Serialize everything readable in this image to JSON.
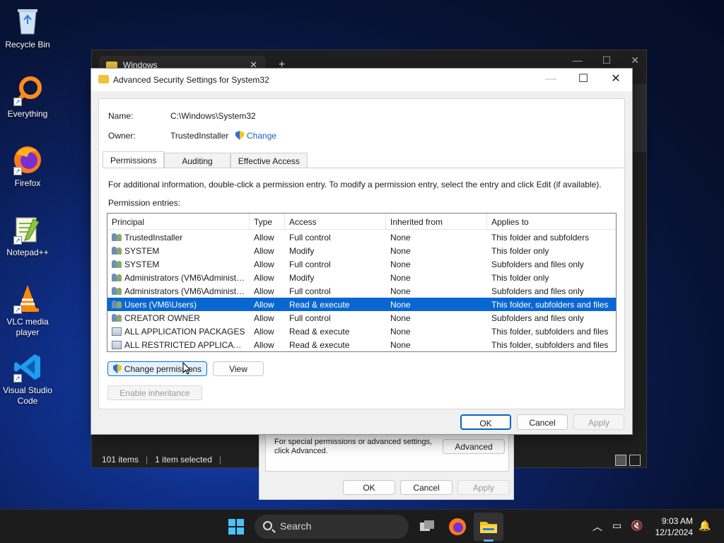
{
  "desktop": {
    "icons": [
      {
        "label": "Recycle Bin"
      },
      {
        "label": "Everything"
      },
      {
        "label": "Firefox"
      },
      {
        "label": "Notepad++"
      },
      {
        "label": "VLC media player"
      },
      {
        "label": "Visual Studio Code"
      }
    ]
  },
  "explorer": {
    "tab_title": "Windows",
    "tab_close": "✕",
    "new_tab": "+",
    "status_items": "101 items",
    "status_selected": "1 item selected"
  },
  "properties": {
    "advanced_text": "For special permissions or advanced settings, click Advanced.",
    "advanced_button": "Advanced",
    "ok": "OK",
    "cancel": "Cancel",
    "apply": "Apply"
  },
  "advanced_security": {
    "title": "Advanced Security Settings for System32",
    "name_label": "Name:",
    "name_value": "C:\\Windows\\System32",
    "owner_label": "Owner:",
    "owner_value": "TrustedInstaller",
    "change_link": "Change",
    "tabs": [
      {
        "label": "Permissions"
      },
      {
        "label": "Auditing"
      },
      {
        "label": "Effective Access"
      }
    ],
    "info_text": "For additional information, double-click a permission entry. To modify a permission entry, select the entry and click Edit (if available).",
    "entries_label": "Permission entries:",
    "columns": {
      "principal": "Principal",
      "type": "Type",
      "access": "Access",
      "inherited": "Inherited from",
      "applies": "Applies to"
    },
    "rows": [
      {
        "principal": "TrustedInstaller",
        "type": "Allow",
        "access": "Full control",
        "inherited": "None",
        "applies": "This folder and subfolders",
        "icon": "user-group-icon"
      },
      {
        "principal": "SYSTEM",
        "type": "Allow",
        "access": "Modify",
        "inherited": "None",
        "applies": "This folder only",
        "icon": "user-group-icon"
      },
      {
        "principal": "SYSTEM",
        "type": "Allow",
        "access": "Full control",
        "inherited": "None",
        "applies": "Subfolders and files only",
        "icon": "user-group-icon"
      },
      {
        "principal": "Administrators (VM6\\Administr...",
        "type": "Allow",
        "access": "Modify",
        "inherited": "None",
        "applies": "This folder only",
        "icon": "user-group-icon"
      },
      {
        "principal": "Administrators (VM6\\Administr...",
        "type": "Allow",
        "access": "Full control",
        "inherited": "None",
        "applies": "Subfolders and files only",
        "icon": "user-group-icon"
      },
      {
        "principal": "Users (VM6\\Users)",
        "type": "Allow",
        "access": "Read & execute",
        "inherited": "None",
        "applies": "This folder, subfolders and files",
        "icon": "user-group-icon",
        "selected": true
      },
      {
        "principal": "CREATOR OWNER",
        "type": "Allow",
        "access": "Full control",
        "inherited": "None",
        "applies": "Subfolders and files only",
        "icon": "user-group-icon"
      },
      {
        "principal": "ALL APPLICATION PACKAGES",
        "type": "Allow",
        "access": "Read & execute",
        "inherited": "None",
        "applies": "This folder, subfolders and files",
        "icon": "package-icon"
      },
      {
        "principal": "ALL RESTRICTED APPLICATION ...",
        "type": "Allow",
        "access": "Read & execute",
        "inherited": "None",
        "applies": "This folder, subfolders and files",
        "icon": "package-icon"
      }
    ],
    "change_permissions": "Change permissions",
    "view": "View",
    "enable_inheritance": "Enable inheritance",
    "ok": "OK",
    "cancel": "Cancel",
    "apply": "Apply"
  },
  "taskbar": {
    "search_label": "Search",
    "time": "9:03 AM",
    "date": "12/1/2024"
  },
  "colors": {
    "selection": "#0a67d1",
    "link": "#1a5fb4"
  }
}
